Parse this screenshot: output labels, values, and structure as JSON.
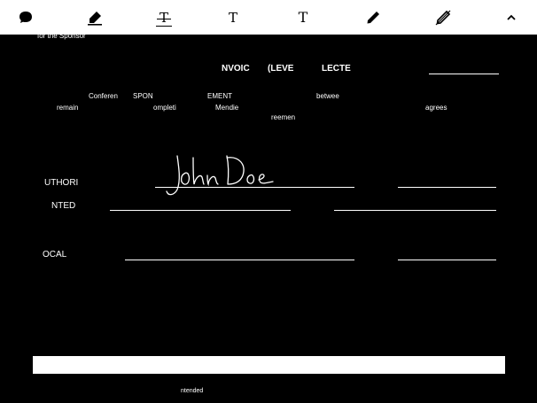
{
  "toolbar": {
    "tools": [
      {
        "name": "comment",
        "icon": "comment-icon"
      },
      {
        "name": "highlight",
        "icon": "highlighter-icon"
      },
      {
        "name": "strikethrough",
        "icon": "strikethrough-icon",
        "glyph": "T"
      },
      {
        "name": "text-insert",
        "icon": "text-insert-icon",
        "glyph": "T"
      },
      {
        "name": "text-box",
        "icon": "text-box-icon",
        "glyph": "T"
      },
      {
        "name": "draw",
        "icon": "pen-icon"
      },
      {
        "name": "erase",
        "icon": "eraser-pen-icon"
      },
      {
        "name": "collapse",
        "icon": "chevron-up-icon"
      }
    ]
  },
  "document": {
    "top_overflow": "for the Sponsor",
    "heading": {
      "part1": "NVOIC",
      "part2": "(LEVE",
      "part3": "LECTE"
    },
    "body_row1": {
      "conferen": "Conferen",
      "spon": "SPON",
      "ement": "EMENT",
      "betwee": "betwee"
    },
    "body_row2": {
      "remain": "remain",
      "ompleti": "ompleti",
      "mendie": "Mendie",
      "agrees": "agrees"
    },
    "body_row3": {
      "reemen": "reemen"
    },
    "signature_rows": [
      {
        "label": "UTHORI"
      },
      {
        "label": "NTED"
      },
      {
        "label": "OCAL"
      }
    ],
    "signature_name": "John Doe",
    "footer_text": "ntended"
  }
}
